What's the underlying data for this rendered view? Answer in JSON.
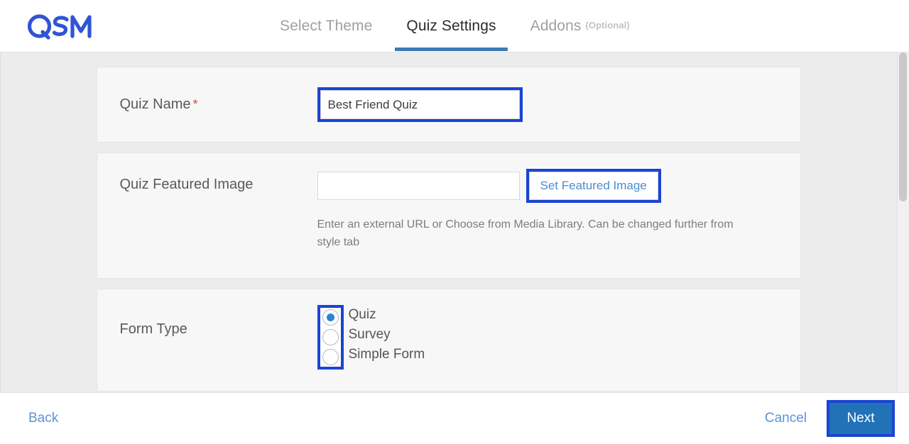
{
  "header": {
    "logo_text": "QSM",
    "logo_color": "#2f55d4",
    "tabs": [
      {
        "label": "Select Theme",
        "active": false,
        "suffix": ""
      },
      {
        "label": "Quiz Settings",
        "active": true,
        "suffix": ""
      },
      {
        "label": "Addons",
        "active": false,
        "suffix": "(Optional)"
      }
    ]
  },
  "form": {
    "quiz_name": {
      "label": "Quiz Name",
      "required_marker": "*",
      "value": "Best Friend Quiz",
      "placeholder": ""
    },
    "featured_image": {
      "label": "Quiz Featured Image",
      "value": "",
      "placeholder": "",
      "button_label": "Set Featured Image",
      "help_text": "Enter an external URL or Choose from Media Library. Can be changed further from style tab"
    },
    "form_type": {
      "label": "Form Type",
      "options": [
        {
          "label": "Quiz",
          "selected": true
        },
        {
          "label": "Survey",
          "selected": false
        },
        {
          "label": "Simple Form",
          "selected": false
        }
      ]
    }
  },
  "footer": {
    "back_label": "Back",
    "cancel_label": "Cancel",
    "next_label": "Next"
  },
  "colors": {
    "highlight_ring": "#1944d4",
    "primary_button": "#2272b8",
    "accent_link": "#5b93d6",
    "tab_underline": "#3b7ab5",
    "required_asterisk": "#e8443a",
    "radio_selected": "#2a84d2"
  }
}
